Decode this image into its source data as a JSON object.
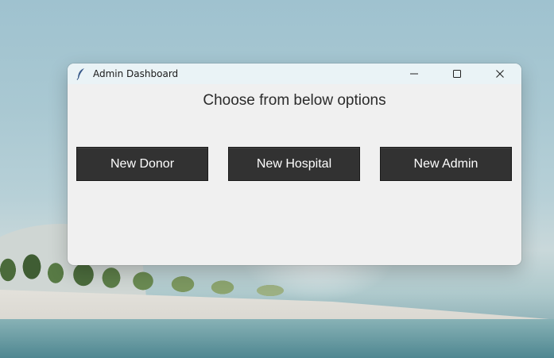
{
  "window": {
    "title": "Admin Dashboard",
    "app_icon": "feather-icon",
    "controls": {
      "minimize_icon": "minimize-icon",
      "maximize_icon": "maximize-icon",
      "close_icon": "close-icon"
    }
  },
  "main": {
    "heading": "Choose from below options",
    "buttons": [
      {
        "label": "New Donor"
      },
      {
        "label": "New Hospital"
      },
      {
        "label": "New Admin"
      }
    ]
  },
  "colors": {
    "button_bg": "#323232",
    "button_text": "#ffffff",
    "window_bg": "#f0f0f0",
    "titlebar_bg": "#eaf3f6"
  }
}
